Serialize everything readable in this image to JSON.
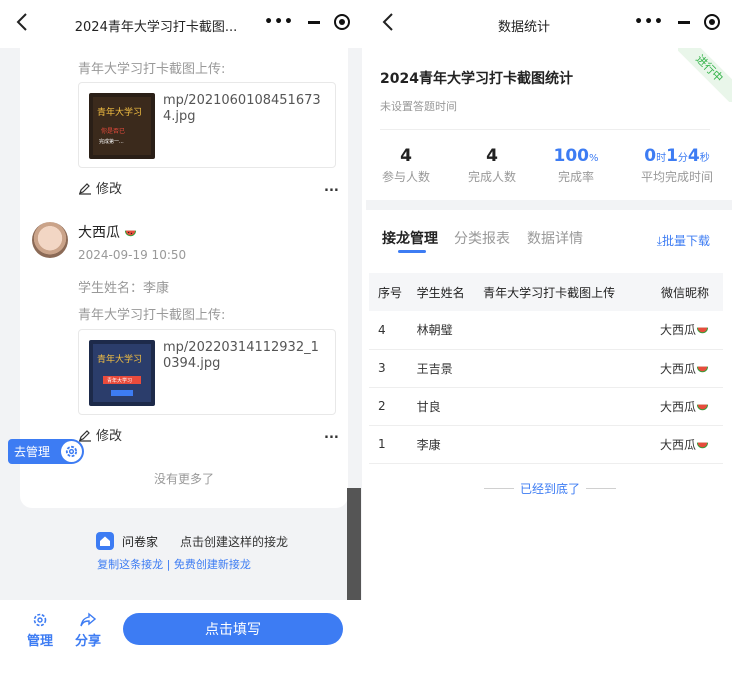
{
  "left": {
    "title": "2024青年大学习打卡截图...",
    "upload_label": "青年大学习打卡截图上传:",
    "entries": [
      {
        "file": "mp/20210601084516734.jpg",
        "edit": "修改",
        "more": "..."
      },
      {
        "user": "大西瓜",
        "date": "2024-09-19 10:50",
        "student": "学生姓名：李康",
        "file": "mp/20220314112932_10394.jpg",
        "edit": "修改",
        "more": "..."
      }
    ],
    "manage_float": "去管理",
    "no_more": "没有更多了",
    "brand": {
      "name": "问卷家",
      "slogan": "点击创建这样的接龙",
      "copy": "复制这条接龙",
      "sep": "|",
      "create": "免费创建新接龙"
    },
    "bottom": {
      "manage": "管理",
      "share": "分享",
      "fill": "点击填写"
    },
    "thumb1": {
      "top": "青年大学习",
      "mid": "你是否已",
      "sub": "完成第一..."
    },
    "thumb2": {
      "top": "青年大学习",
      "mid": "青年大学习"
    }
  },
  "right": {
    "title": "数据统计",
    "survey_title": "2024青年大学习打卡截图统计",
    "subtitle": "未设置答题时间",
    "ribbon": "进行中",
    "stats": [
      {
        "value": "4",
        "label": "参与人数"
      },
      {
        "value": "4",
        "label": "完成人数"
      },
      {
        "value": "100",
        "unit": "%",
        "label": "完成率"
      },
      {
        "h": "0",
        "hu": "时",
        "m": "1",
        "mu": "分",
        "s": "4",
        "su": "秒",
        "label": "平均完成时间"
      }
    ],
    "tabs": [
      "接龙管理",
      "分类报表",
      "数据详情"
    ],
    "download": "⤓批量下载",
    "table": {
      "headers": [
        "序号",
        "学生姓名",
        "青年大学习打卡截图上传",
        "微信昵称"
      ],
      "rows": [
        [
          "4",
          "林朝璧",
          "",
          "大西瓜"
        ],
        [
          "3",
          "王吉景",
          "",
          "大西瓜"
        ],
        [
          "2",
          "甘良",
          "",
          "大西瓜"
        ],
        [
          "1",
          "李康",
          "",
          "大西瓜"
        ]
      ]
    },
    "end": "已经到底了"
  }
}
